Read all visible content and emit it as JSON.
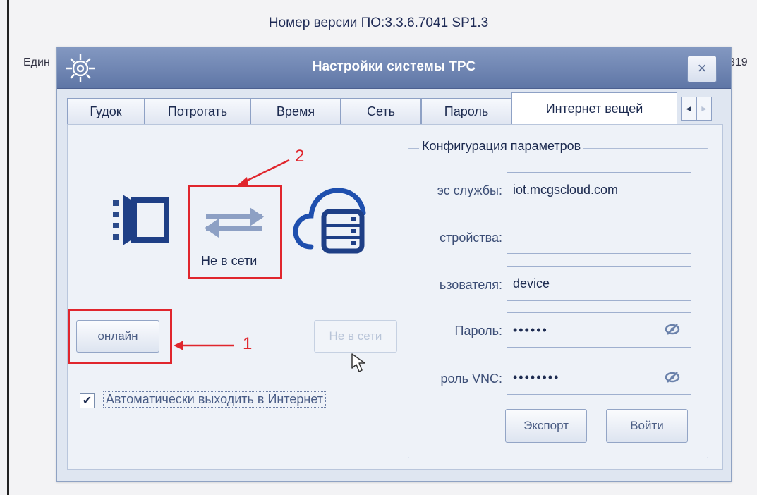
{
  "header": {
    "version_text": "Номер версии ПО:3.3.6.7041 SP1.3",
    "left_edge_text": "Един",
    "right_edge_text": "319"
  },
  "dialog": {
    "title": "Настройки системы TPC",
    "close_symbol": "×",
    "tabs": [
      {
        "label": "Гудок"
      },
      {
        "label": "Потрогать"
      },
      {
        "label": "Время"
      },
      {
        "label": "Сеть"
      },
      {
        "label": "Пароль"
      },
      {
        "label": "Интернет вещей",
        "active": true
      }
    ],
    "tab_scroll_left": "◄",
    "tab_scroll_right": "►"
  },
  "connection": {
    "status_label": "Не в сети",
    "device_icon": "device-icon",
    "link_icon": "transfer-arrows-icon",
    "cloud_icon": "cloud-server-icon",
    "online_button": "онлайн",
    "offline_button": "Не в сети",
    "auto_online_checked": true,
    "auto_online_label": "Автоматически выходить в Интернет"
  },
  "config": {
    "legend": "Конфигурация параметров",
    "fields": [
      {
        "label": "эс службы:",
        "value": "iot.mcgscloud.com"
      },
      {
        "label": "стройства:",
        "value": ""
      },
      {
        "label": "ьзователя:",
        "value": "device"
      },
      {
        "label": "Пароль:",
        "value": "••••••"
      },
      {
        "label": "роль VNC:",
        "value": "••••••••"
      }
    ],
    "export_button": "Экспорт",
    "login_button": "Войти"
  },
  "annotations": {
    "marker_1": "1",
    "marker_2": "2",
    "color": "#e0262d"
  }
}
